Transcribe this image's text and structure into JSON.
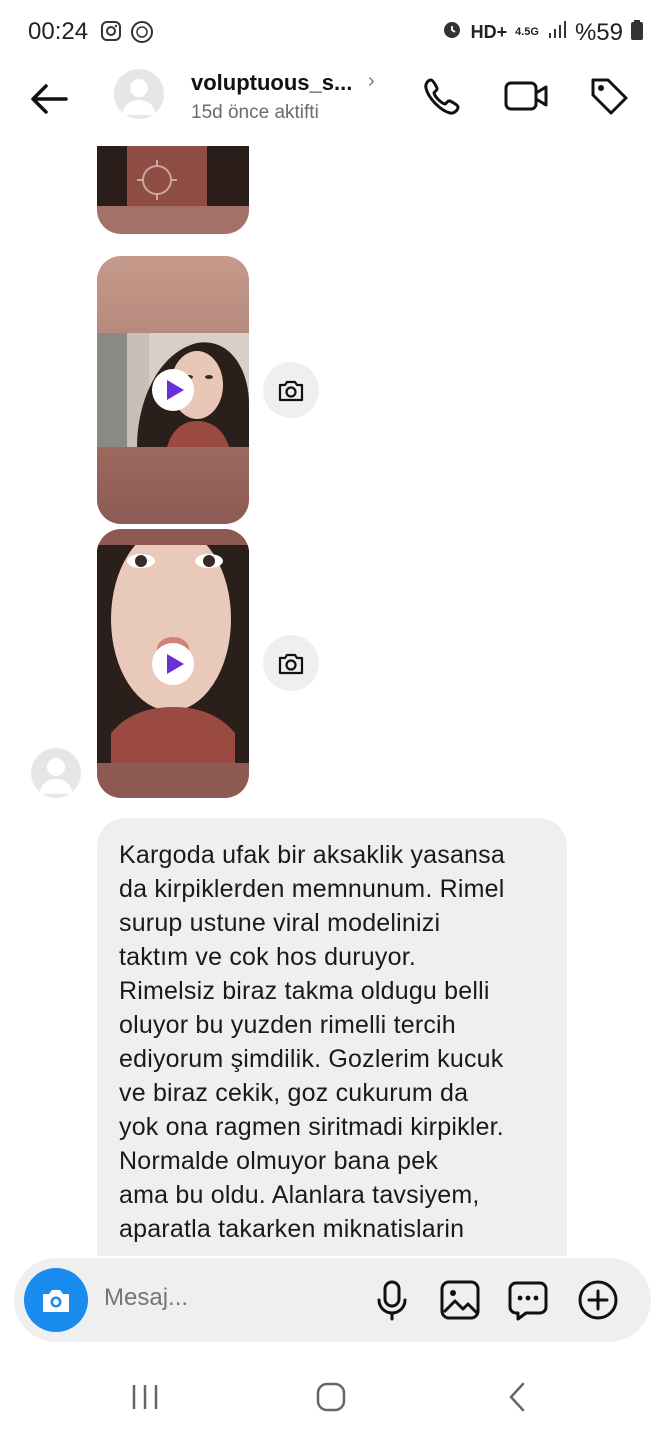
{
  "status_bar": {
    "time": "00:24",
    "network": "4.5G",
    "battery": "%59",
    "hd_badge": "HD+"
  },
  "header": {
    "username": "voluptuous_s...",
    "chevron": "›",
    "activity": "15d önce aktifti",
    "icons": [
      "back-arrow-icon",
      "phone-icon",
      "video-icon",
      "tag-icon"
    ]
  },
  "message": {
    "text": "Kargoda ufak bir aksaklik yasansa\nda kirpiklerden memnunum. Rimel\nsurup ustune viral modelinizi\ntaktım ve cok hos duruyor.\nRimelsiz biraz takma oldugu belli\noluyor bu yuzden rimelli tercih\nediyorum şimdilik. Gozlerim kucuk\nve biraz cekik, goz cukurum da\nyok ona ragmen siritmadi kirpikler.\nNormalde olmuyor bana pek\nama bu oldu. Alanlara tavsiyem,\naparatla takarken miknatislarin"
  },
  "composer": {
    "placeholder": "Mesaj...",
    "icons": [
      "camera-icon",
      "microphone-icon",
      "gallery-icon",
      "sticker-icon",
      "plus-icon"
    ]
  },
  "colors": {
    "accent": "#1a8cf0",
    "play": "#6b2fd6",
    "bubble": "#efefef"
  }
}
